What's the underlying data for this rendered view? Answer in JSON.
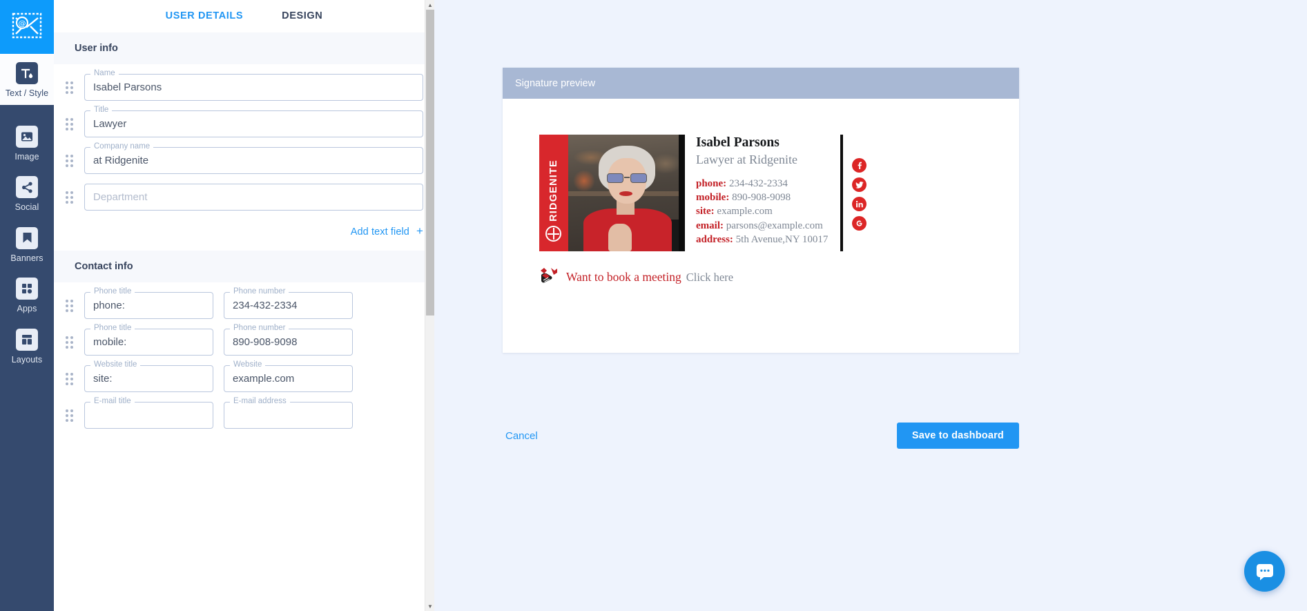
{
  "rail": {
    "logo_icon": "stamp-envelope-at-icon",
    "items": [
      {
        "label": "Text / Style",
        "icon": "text-style-icon",
        "active": true
      },
      {
        "label": "Image",
        "icon": "image-icon",
        "active": false
      },
      {
        "label": "Social",
        "icon": "share-icon",
        "active": false
      },
      {
        "label": "Banners",
        "icon": "bookmark-icon",
        "active": false
      },
      {
        "label": "Apps",
        "icon": "grid-apps-icon",
        "active": false
      },
      {
        "label": "Layouts",
        "icon": "layouts-icon",
        "active": false
      }
    ]
  },
  "tabs": [
    {
      "label": "USER DETAILS",
      "active": true
    },
    {
      "label": "DESIGN",
      "active": false
    }
  ],
  "sections": {
    "user_info": {
      "title": "User info",
      "fields": [
        {
          "legend": "Name",
          "value": "Isabel Parsons",
          "placeholder": ""
        },
        {
          "legend": "Title",
          "value": "Lawyer",
          "placeholder": ""
        },
        {
          "legend": "Company name",
          "value": "at Ridgenite",
          "placeholder": ""
        },
        {
          "legend": "",
          "value": "",
          "placeholder": "Department"
        }
      ],
      "add_field_label": "Add text field",
      "add_field_plus": "+"
    },
    "contact_info": {
      "title": "Contact info",
      "rows": [
        {
          "left": {
            "legend": "Phone title",
            "value": "phone:",
            "placeholder": ""
          },
          "right": {
            "legend": "Phone number",
            "value": "234-432-2334",
            "placeholder": ""
          }
        },
        {
          "left": {
            "legend": "Phone title",
            "value": "mobile:",
            "placeholder": ""
          },
          "right": {
            "legend": "Phone number",
            "value": "890-908-9098",
            "placeholder": ""
          }
        },
        {
          "left": {
            "legend": "Website title",
            "value": "site:",
            "placeholder": ""
          },
          "right": {
            "legend": "Website",
            "value": "example.com",
            "placeholder": ""
          }
        },
        {
          "left": {
            "legend": "E-mail title",
            "value": "",
            "placeholder": ""
          },
          "right": {
            "legend": "E-mail address",
            "value": "",
            "placeholder": ""
          }
        }
      ]
    }
  },
  "preview": {
    "header": "Signature preview",
    "signature": {
      "brand_band_text": "RIDGENITE",
      "name": "Isabel Parsons",
      "role": "Lawyer at Ridgenite",
      "contacts": [
        {
          "label": "phone:",
          "value": "234-432-2334"
        },
        {
          "label": "mobile:",
          "value": "890-908-9098"
        },
        {
          "label": "site:",
          "value": "example.com"
        },
        {
          "label": "email:",
          "value": "parsons@example.com"
        },
        {
          "label": "address:",
          "value": "5th Avenue,NY 10017"
        }
      ],
      "social": [
        {
          "name": "facebook-icon"
        },
        {
          "name": "twitter-icon"
        },
        {
          "name": "linkedin-icon"
        },
        {
          "name": "google-icon"
        }
      ],
      "cta": {
        "icon": "handshake-icon",
        "text": "Want to book a meeting",
        "link": "Click here"
      }
    }
  },
  "actions": {
    "cancel": "Cancel",
    "save": "Save to dashboard"
  },
  "widgets": {
    "chat_icon": "chat-bubble-icon"
  },
  "colors": {
    "accent_blue": "#2196f3",
    "rail_bg": "#354a6e",
    "logo_bg": "#0d9bfb",
    "preview_bg": "#eef3fd",
    "card_header": "#a8b8d4",
    "brand_red": "#c32026",
    "social_red": "#dc2626"
  }
}
